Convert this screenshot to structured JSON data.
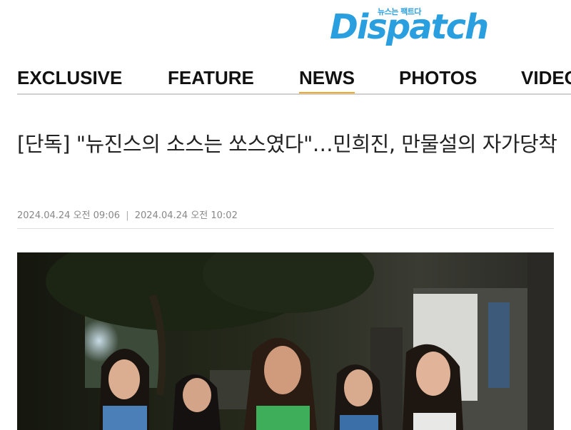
{
  "logo": {
    "wordmark": "Dispatch",
    "tagline": "뉴스는 팩트다"
  },
  "nav": {
    "items": [
      {
        "label": "EXCLUSIVE"
      },
      {
        "label": "FEATURE"
      },
      {
        "label": "NEWS"
      },
      {
        "label": "PHOTOS"
      },
      {
        "label": "VIDEO"
      }
    ],
    "active": "NEWS",
    "accent_color": "#f5a623"
  },
  "article": {
    "title": "[단독] \"뉴진스의 소스는 쏘스였다\"…민희진, 만물설의 자가당착",
    "published": "2024.04.24 오전 09:06",
    "updated": "2024.04.24 오전 10:02",
    "separator": "|"
  },
  "photo": {
    "icon": "photo-image"
  },
  "colors": {
    "brand": "#2a9fe0",
    "text": "#222222",
    "meta": "#888888"
  }
}
